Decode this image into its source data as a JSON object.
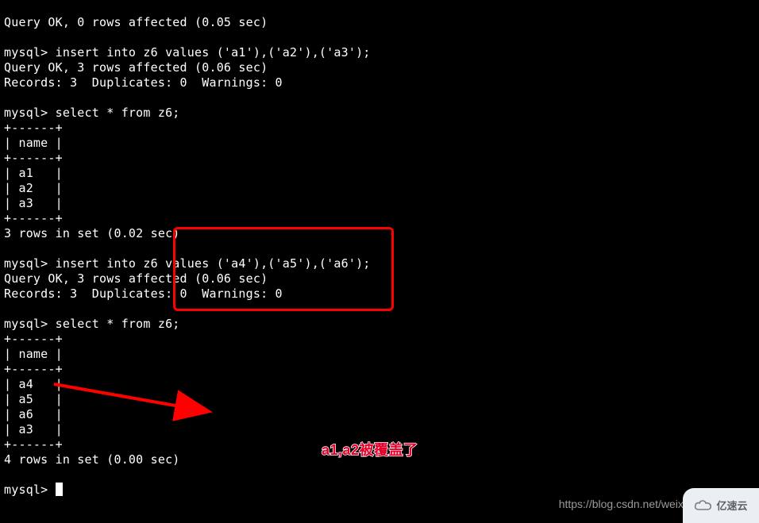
{
  "terminal": {
    "lines": [
      "Query OK, 0 rows affected (0.05 sec)",
      "",
      "mysql> insert into z6 values ('a1'),('a2'),('a3');",
      "Query OK, 3 rows affected (0.06 sec)",
      "Records: 3  Duplicates: 0  Warnings: 0",
      "",
      "mysql> select * from z6;",
      "+------+",
      "| name |",
      "+------+",
      "| a1   |",
      "| a2   |",
      "| a3   |",
      "+------+",
      "3 rows in set (0.02 sec)",
      "",
      "mysql> insert into z6 values ('a4'),('a5'),('a6');",
      "Query OK, 3 rows affected (0.06 sec)",
      "Records: 3  Duplicates: 0  Warnings: 0",
      "",
      "mysql> select * from z6;",
      "+------+",
      "| name |",
      "+------+",
      "| a4   |",
      "| a5   |",
      "| a6   |",
      "| a3   |",
      "+------+",
      "4 rows in set (0.00 sec)",
      ""
    ],
    "prompt": "mysql> "
  },
  "annotation_text": "a1,a2被覆盖了",
  "watermark": {
    "url_text": "https://blog.csdn.net/weixi",
    "logo_text": "亿速云"
  }
}
